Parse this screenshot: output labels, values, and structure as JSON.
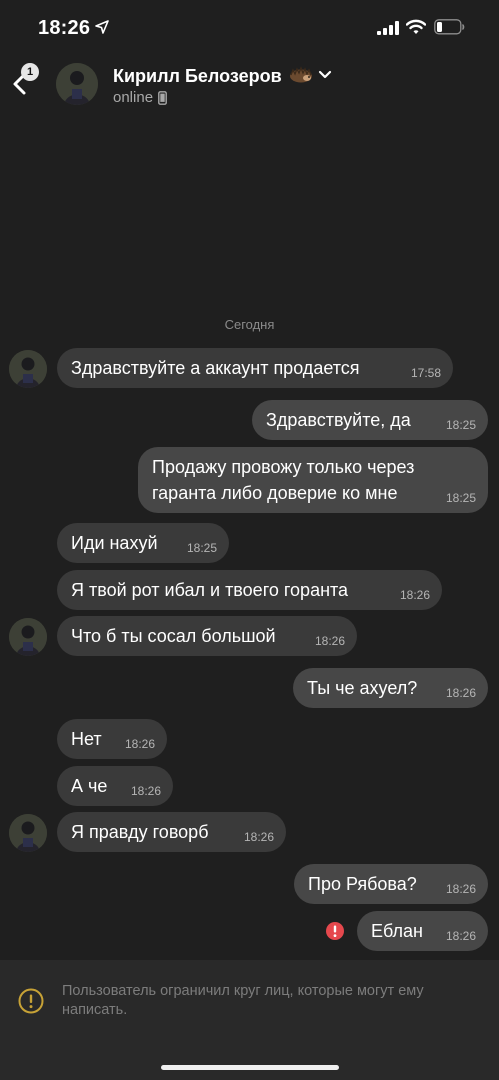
{
  "status_bar": {
    "time": "18:26"
  },
  "header": {
    "back_badge": "1",
    "contact_name": "Кирилл Белозеров",
    "status": "online",
    "name_emoji": "hedgehog-icon"
  },
  "date_separator": "Сегодня",
  "messages": [
    {
      "side": "in",
      "text": "Здравствуйте а аккаунт продается",
      "time": "17:58"
    },
    {
      "side": "out",
      "text": "Здравствуйте, да",
      "time": "18:25"
    },
    {
      "side": "out",
      "lines": [
        "Продажу провожу только через",
        "гаранта либо доверие ко мне"
      ],
      "time": "18:25"
    },
    {
      "side": "in",
      "text": "Иди нахуй",
      "time": "18:25"
    },
    {
      "side": "in",
      "text": "Я твой рот ибал и твоего горанта",
      "time": "18:26"
    },
    {
      "side": "in",
      "text": "Что б ты сосал большой",
      "time": "18:26"
    },
    {
      "side": "out",
      "text": "Ты че ахуел?",
      "time": "18:26"
    },
    {
      "side": "in",
      "text": "Нет",
      "time": "18:26"
    },
    {
      "side": "in",
      "text": "А че",
      "time": "18:26"
    },
    {
      "side": "in",
      "text": "Я правду говорб",
      "time": "18:26"
    },
    {
      "side": "out",
      "text": "Про Рябова?",
      "time": "18:26"
    },
    {
      "side": "out",
      "text": "Еблан",
      "time": "18:26",
      "failed": true
    }
  ],
  "footer": {
    "notice": "Пользователь ограничил круг лиц, которые могут ему написать."
  },
  "colors": {
    "background": "#1f1f1f",
    "bubble_in": "#3a3a3a",
    "bubble_out": "#474747",
    "error": "#e5484d",
    "warning": "#c7a236"
  }
}
